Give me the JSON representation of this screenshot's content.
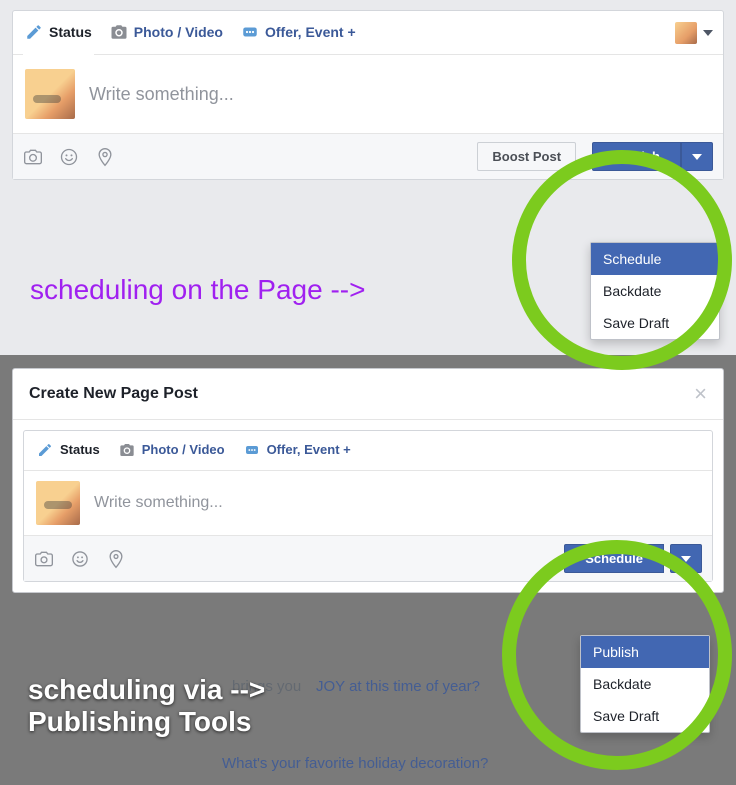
{
  "top": {
    "tabs": {
      "status": "Status",
      "photo": "Photo / Video",
      "offer": "Offer, Event +"
    },
    "placeholder": "Write something...",
    "boost": "Boost Post",
    "publish": "Publish",
    "dropdown": {
      "schedule": "Schedule",
      "backdate": "Backdate",
      "draft": "Save Draft"
    }
  },
  "annot1": "scheduling on the Page -->",
  "modal": {
    "title": "Create New Page Post",
    "tabs": {
      "status": "Status",
      "photo": "Photo / Video",
      "offer": "Offer, Event +"
    },
    "placeholder": "Write something...",
    "schedule": "Schedule",
    "dropdown": {
      "publish": "Publish",
      "backdate": "Backdate",
      "draft": "Save Draft"
    }
  },
  "annot2_l1": "scheduling via -->",
  "annot2_l2": "Publishing Tools",
  "bg_text1": "JOY at this time of year?",
  "bg_text2": "brings you",
  "bg_text3": "What's your favorite holiday decoration?"
}
